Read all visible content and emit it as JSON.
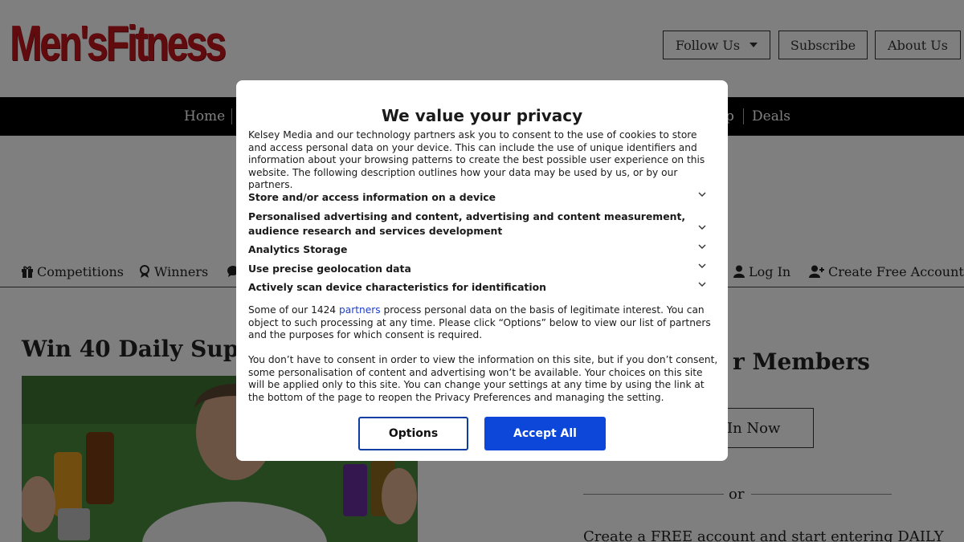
{
  "header": {
    "logo": "Men'sFitness",
    "buttons": {
      "follow": "Follow Us",
      "subscribe": "Subscribe",
      "about": "About Us"
    }
  },
  "nav": {
    "home": "Home",
    "partial": "p",
    "deals": "Deals"
  },
  "subnav": {
    "competitions": "Competitions",
    "winners": "Winners",
    "login": "Log In",
    "create": "Create Free Account"
  },
  "page": {
    "headline": "Win 40 Daily Super",
    "members": "r Members",
    "login_box": "In Now",
    "or": "or",
    "create_text": "Create a FREE account and start entering DAILY"
  },
  "modal": {
    "title": "We value your privacy",
    "intro": "Kelsey Media and our technology partners ask you to consent to the use of cookies to store and access personal data on your device. This can include the use of unique identifiers and information about your browsing patterns to create the best possible user experience on this website. The following description outlines how your data may be used by us, or by our partners.",
    "purposes": [
      "Store and/or access information on a device",
      "Personalised advertising and content, advertising and content measurement, audience research and services development",
      "Analytics Storage",
      "Use precise geolocation data",
      "Actively scan device characteristics for identification"
    ],
    "legit_pre": "Some of our 1424 ",
    "legit_link": "partners",
    "legit_post": " process personal data on the basis of legitimate interest. You can object to such processing at any time. Please click “Options” below to view our list of partners and the purposes for which consent is required.",
    "consent_text": "You don’t have to consent in order to view the information on this site, but if you don’t consent, some personalisation of content and advertising won’t be available. Your choices on this site will be applied only to this site. You can change your settings at any time by using the link at the bottom of the page to reopen the Privacy Preferences and managing the setting.",
    "options_label": "Options",
    "accept_label": "Accept All"
  },
  "colors": {
    "brand_red": "#c4161c",
    "accept_blue": "#0d47d9",
    "nav_bg": "#000000"
  }
}
